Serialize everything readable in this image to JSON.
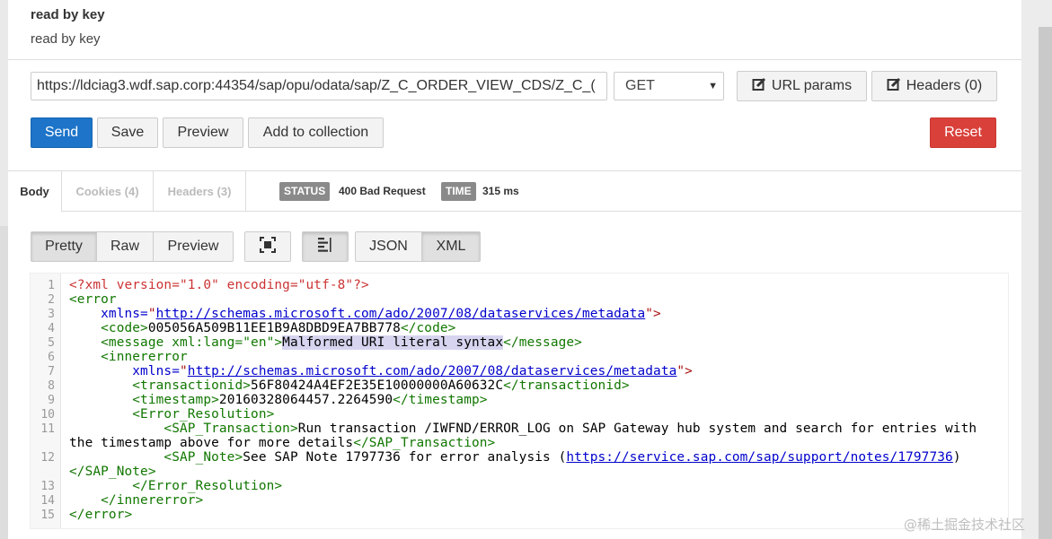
{
  "request": {
    "title": "read by key",
    "description": "read by key",
    "url": "https://ldciag3.wdf.sap.corp:44354/sap/opu/odata/sap/Z_C_ORDER_VIEW_CDS/Z_C_(",
    "method": "GET",
    "url_params_label": "URL params",
    "headers_label": "Headers (0)"
  },
  "actions": {
    "send": "Send",
    "save": "Save",
    "preview": "Preview",
    "add_to_collection": "Add to collection",
    "reset": "Reset"
  },
  "response": {
    "tabs": [
      "Body",
      "Cookies (4)",
      "Headers (3)"
    ],
    "status_label": "STATUS",
    "status_value": "400 Bad Request",
    "time_label": "TIME",
    "time_value": "315 ms",
    "view_modes": [
      "Pretty",
      "Raw",
      "Preview"
    ],
    "formats": [
      "JSON",
      "XML"
    ],
    "active_view": "Pretty",
    "active_format": "XML"
  },
  "code": {
    "line_numbers": [
      "1",
      "2",
      "3",
      "4",
      "5",
      "6",
      "7",
      "8",
      "9",
      "10",
      "11",
      "",
      "12",
      "",
      "13",
      "14",
      "15"
    ],
    "l1": "<?xml version=\"1.0\" encoding=\"utf-8\"?>",
    "l2": "<error",
    "l3_attr": "    xmlns=",
    "l3_q1": "\"",
    "l3_link": "http://schemas.microsoft.com/ado/2007/08/dataservices/metadata",
    "l3_end": "\">",
    "l4_open": "    <code>",
    "l4_txt": "005056A509B11EE1B9A8DBD9EA7BB778",
    "l4_close": "</code>",
    "l5_open": "    <message xml:lang=\"en\">",
    "l5_txt": "Malformed URI literal syntax",
    "l5_close": "</message>",
    "l6": "    <innererror",
    "l7_attr": "        xmlns=",
    "l7_q1": "\"",
    "l7_link": "http://schemas.microsoft.com/ado/2007/08/dataservices/metadata",
    "l7_end": "\">",
    "l8_open": "        <transactionid>",
    "l8_txt": "56F80424A4EF2E35E10000000A60632C",
    "l8_close": "</transactionid>",
    "l9_open": "        <timestamp>",
    "l9_txt": "20160328064457.2264590",
    "l9_close": "</timestamp>",
    "l10": "        <Error_Resolution>",
    "l11_open": "            <SAP_Transaction>",
    "l11_txt": "Run transaction /IWFND/ERROR_LOG on SAP Gateway hub system and search for entries with",
    "l11b_txt": "the timestamp above for more details",
    "l11b_close": "</SAP_Transaction>",
    "l12_open": "            <SAP_Note>",
    "l12_txt": "See SAP Note 1797736 for error analysis (",
    "l12_link": "https://service.sap.com/sap/support/notes/1797736",
    "l12_end": ")",
    "l12b_close": "</SAP_Note>",
    "l13": "        </Error_Resolution>",
    "l14": "    </innererror>",
    "l15": "</error>"
  },
  "watermark": "@稀土掘金技术社区"
}
